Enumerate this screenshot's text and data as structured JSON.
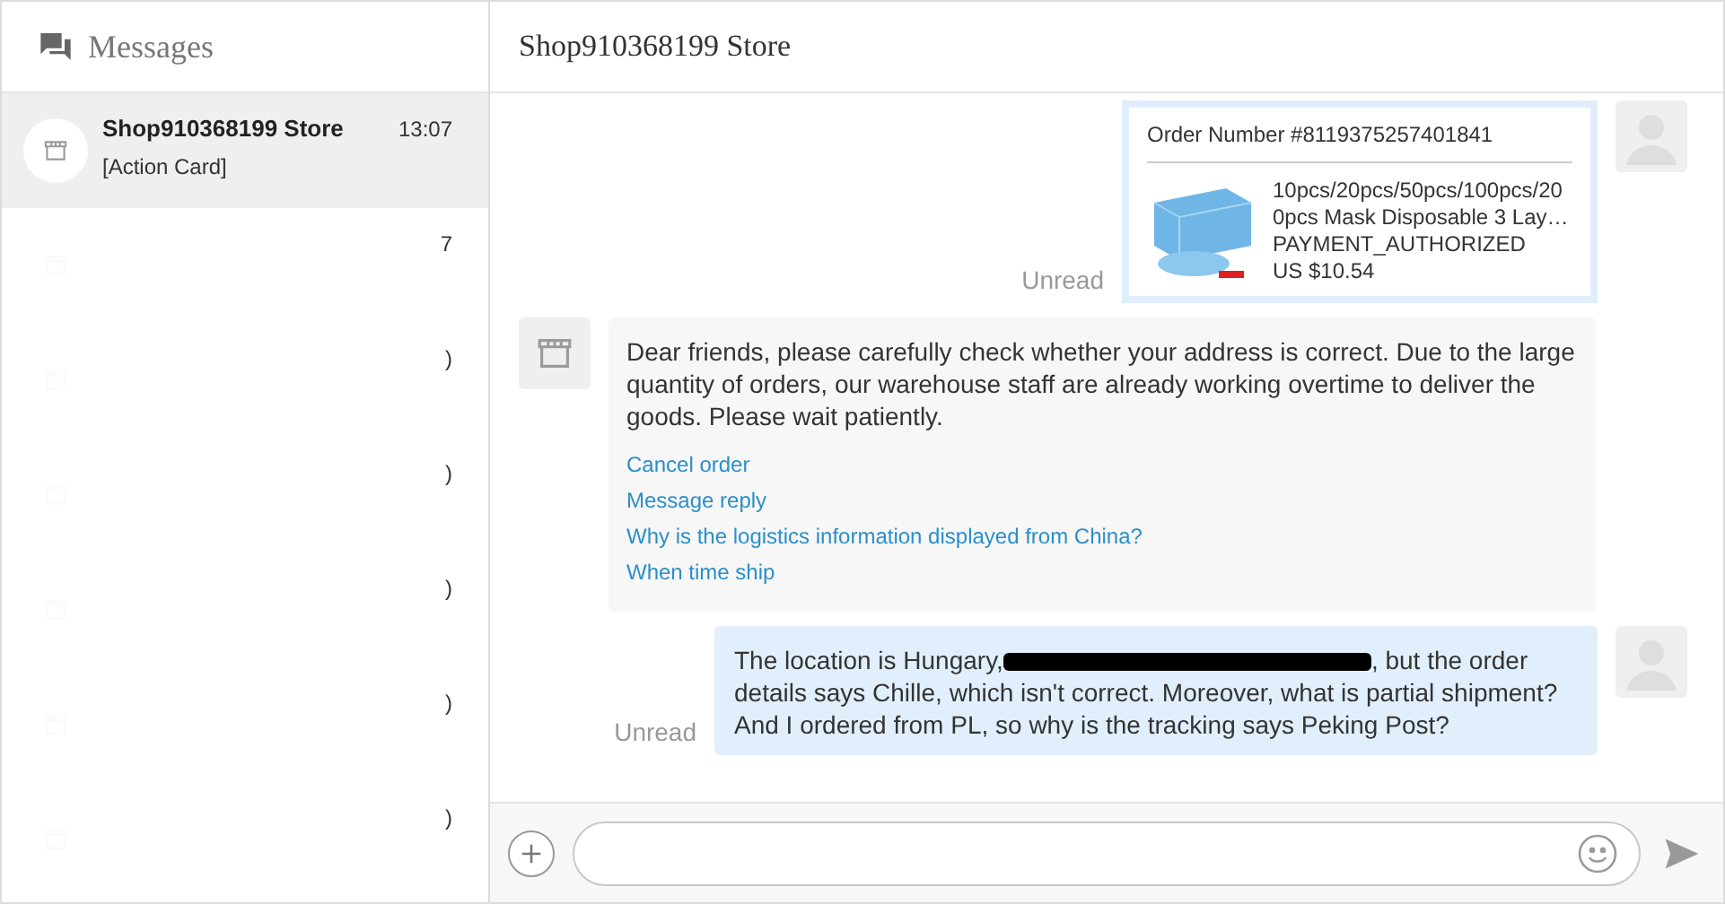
{
  "sidebar": {
    "title": "Messages",
    "conversations": [
      {
        "name": "Shop910368199 Store",
        "time": "13:07",
        "preview": "[Action Card]",
        "selected": true,
        "redacted": false
      },
      {
        "time": "7",
        "selected": false,
        "redacted": true
      },
      {
        "time": ")",
        "selected": false,
        "redacted": true
      },
      {
        "time": ")",
        "selected": false,
        "redacted": true
      },
      {
        "time": ")",
        "selected": false,
        "redacted": true
      },
      {
        "time": ")",
        "selected": false,
        "redacted": true
      },
      {
        "time": ")",
        "selected": false,
        "redacted": true
      }
    ]
  },
  "chat": {
    "title": "Shop910368199 Store",
    "messages": [
      {
        "kind": "order",
        "outgoing": true,
        "status": "Unread",
        "order_number": "Order Number #8119375257401841",
        "product": "10pcs/20pcs/50pcs/100pcs/200pcs Mask Disposable 3 Lay…",
        "payment_status": "PAYMENT_AUTHORIZED",
        "price": "US $10.54"
      },
      {
        "kind": "action",
        "outgoing": false,
        "text": "Dear friends, please carefully check whether your address is correct. Due to the large quantity of orders, our warehouse staff are already working overtime to deliver the goods. Please wait patiently.",
        "actions": [
          "Cancel order",
          "Message reply",
          "Why is the logistics information displayed from China?",
          "When time ship"
        ]
      },
      {
        "kind": "text",
        "outgoing": true,
        "status": "Unread",
        "text_before": "The location is Hungary,",
        "redacted": true,
        "text_after": ", but the order details says Chille, which isn't correct. Moreover, what is partial shipment? And I ordered from PL, so why is the tracking says Peking Post?"
      }
    ]
  }
}
